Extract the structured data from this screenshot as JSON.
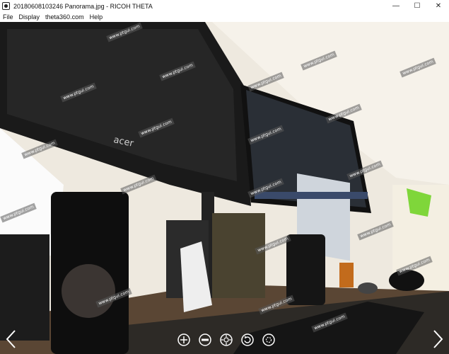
{
  "window": {
    "title": "20180608103246 Panorama.jpg - RICOH THETA",
    "minimize_symbol": "—",
    "maximize_symbol": "☐",
    "close_symbol": "✕"
  },
  "menu": {
    "items": [
      "File",
      "Display",
      "theta360.com",
      "Help"
    ]
  },
  "viewer": {
    "watermark_text": "www.ptgui.com",
    "monitor_brand": "acer"
  },
  "toolbar": {
    "icons": [
      "zoom-in-icon",
      "zoom-out-icon",
      "sphere-view-icon",
      "rotate-icon",
      "auto-play-icon"
    ]
  },
  "colors": {
    "accent_green": "#7fd63a",
    "toolbar_icon": "#ffffff"
  }
}
